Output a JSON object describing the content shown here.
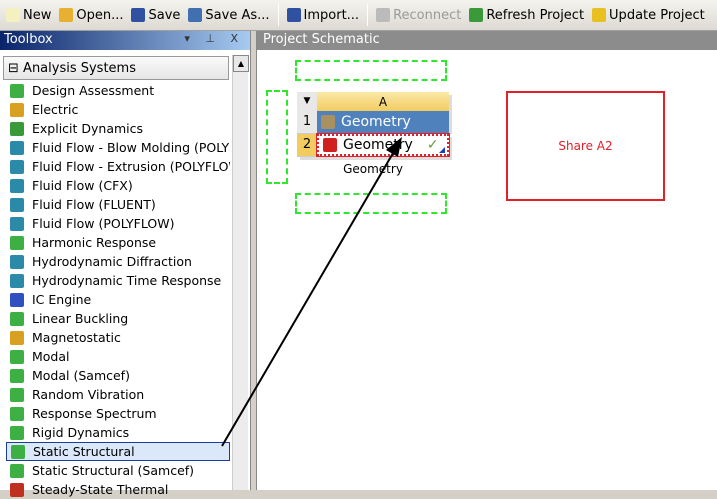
{
  "toolbar": {
    "items": [
      {
        "label": "New",
        "icon": "new-icon",
        "enabled": true
      },
      {
        "label": "Open...",
        "icon": "open-folder-icon",
        "enabled": true
      },
      {
        "label": "Save",
        "icon": "save-icon",
        "enabled": true
      },
      {
        "label": "Save As...",
        "icon": "save-as-icon",
        "enabled": true
      },
      {
        "label": "Import...",
        "icon": "import-icon",
        "enabled": true
      },
      {
        "label": "Reconnect",
        "icon": "reconnect-icon",
        "enabled": false
      },
      {
        "label": "Refresh Project",
        "icon": "refresh-icon",
        "enabled": true
      },
      {
        "label": "Update Project",
        "icon": "lightning-icon",
        "enabled": true
      }
    ]
  },
  "toolbox": {
    "title": "Toolbox",
    "controls": "▾ ⊥ X",
    "category": "Analysis Systems",
    "category_toggle": "⊟",
    "items": [
      {
        "label": "Design Assessment",
        "color": "#3cb043"
      },
      {
        "label": "Electric",
        "color": "#d9a020"
      },
      {
        "label": "Explicit Dynamics",
        "color": "#3a9a3a"
      },
      {
        "label": "Fluid Flow - Blow Molding (POLYFLOW)",
        "color": "#2a8aa8"
      },
      {
        "label": "Fluid Flow - Extrusion (POLYFLOW)",
        "color": "#2a8aa8"
      },
      {
        "label": "Fluid Flow (CFX)",
        "color": "#2a8aa8"
      },
      {
        "label": "Fluid Flow (FLUENT)",
        "color": "#2a8aa8"
      },
      {
        "label": "Fluid Flow (POLYFLOW)",
        "color": "#2a8aa8"
      },
      {
        "label": "Harmonic Response",
        "color": "#3cb043"
      },
      {
        "label": "Hydrodynamic Diffraction",
        "color": "#2a8aa8"
      },
      {
        "label": "Hydrodynamic Time Response",
        "color": "#2a8aa8"
      },
      {
        "label": "IC Engine",
        "color": "#3050c0"
      },
      {
        "label": "Linear Buckling",
        "color": "#3cb043"
      },
      {
        "label": "Magnetostatic",
        "color": "#d9a020"
      },
      {
        "label": "Modal",
        "color": "#3cb043"
      },
      {
        "label": "Modal (Samcef)",
        "color": "#3cb043"
      },
      {
        "label": "Random Vibration",
        "color": "#3cb043"
      },
      {
        "label": "Response Spectrum",
        "color": "#3cb043"
      },
      {
        "label": "Rigid Dynamics",
        "color": "#3cb043"
      },
      {
        "label": "Static Structural",
        "color": "#3cb043",
        "selected": true
      },
      {
        "label": "Static Structural (Samcef)",
        "color": "#3cb043"
      },
      {
        "label": "Steady-State Thermal",
        "color": "#c03020"
      }
    ]
  },
  "schematic": {
    "title": "Project Schematic",
    "system": {
      "column": "A",
      "rows": [
        {
          "num": "1",
          "label": "Geometry"
        },
        {
          "num": "2",
          "label": "Geometry",
          "status": "✓"
        }
      ],
      "name": "Geometry"
    },
    "drop_target": "Share A2"
  }
}
